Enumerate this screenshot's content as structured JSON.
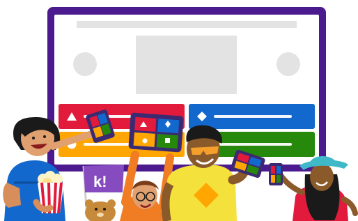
{
  "illustration": {
    "flag_text": "k!",
    "colors": {
      "frame": "#4b1a8f",
      "answer_red": "#e21b3c",
      "answer_blue": "#1368ce",
      "answer_yellow": "#ffa602",
      "answer_green": "#26890c",
      "placeholder": "#e3e3e3"
    },
    "answer_shapes": [
      "triangle",
      "diamond",
      "circle",
      "square"
    ]
  }
}
